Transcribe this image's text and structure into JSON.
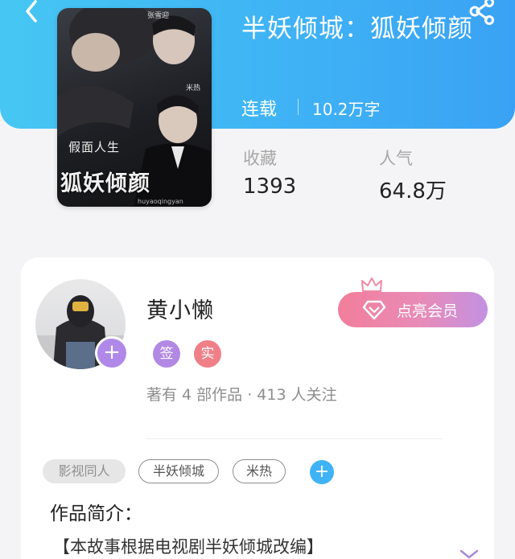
{
  "header": {
    "back_icon": "chevron-left-icon",
    "share_icon": "share-icon",
    "gradient_colors": [
      "#46c7f3",
      "#3aa2f4"
    ]
  },
  "book": {
    "cover": {
      "subtitle": "假面人生",
      "title": "狐妖倾颜",
      "actor_name_1": "张雪迎",
      "actor_name_2": "米热",
      "watermark": "huyaoqingyan"
    },
    "title": "半妖倾城：狐妖倾颜",
    "status": "连载",
    "word_count": "10.2万字"
  },
  "stats": {
    "favorites_label": "收藏",
    "favorites_value": "1393",
    "popularity_label": "人气",
    "popularity_value": "64.8万"
  },
  "author": {
    "name": "黄小懒",
    "follow_button": "+",
    "badge_signed": "签",
    "badge_verified": "实",
    "meta": "著有 4 部作品 · 413 人关注",
    "vip_button": "点亮会员"
  },
  "tags": {
    "items": [
      "影视同人",
      "半妖倾城",
      "米热"
    ],
    "add_button": "+",
    "accent": "#3fb3f5"
  },
  "intro": {
    "heading": "作品简介：",
    "text": "【本故事根据电视剧半妖倾城改编】"
  }
}
